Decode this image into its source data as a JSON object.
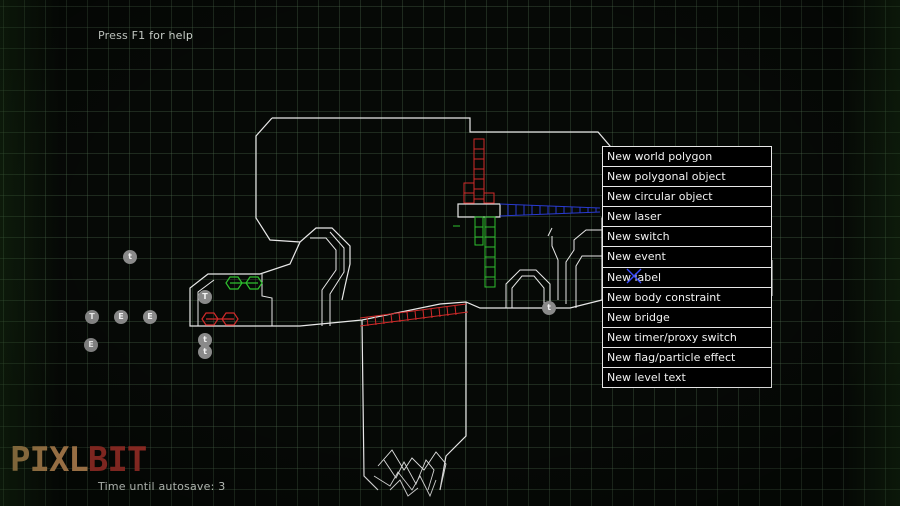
{
  "hud": {
    "help_text": "Press F1 for help",
    "autosave_text": "Time until autosave: 3"
  },
  "logo": {
    "part1": "PIXL",
    "part2": "BIT"
  },
  "context_menu": {
    "items": [
      "New world polygon",
      "New polygonal object",
      "New circular object",
      "New laser",
      "New switch",
      "New event",
      "New label",
      "New body constraint",
      "New bridge",
      "New timer/proxy switch",
      "New flag/particle effect",
      "New level text"
    ]
  },
  "markers": [
    {
      "label": "t"
    },
    {
      "label": "T"
    },
    {
      "label": "T"
    },
    {
      "label": "E"
    },
    {
      "label": "E"
    },
    {
      "label": "E"
    },
    {
      "label": "t"
    },
    {
      "label": "t"
    },
    {
      "label": "t"
    }
  ],
  "colors": {
    "grid": "#4f6e4f",
    "outline": "#e8e8e8",
    "red_object": "#d02a2a",
    "green_object": "#2ec02e",
    "blue_object": "#2a3bd0",
    "cursor": "#3a4cff",
    "marker": "#8a8a8a"
  }
}
